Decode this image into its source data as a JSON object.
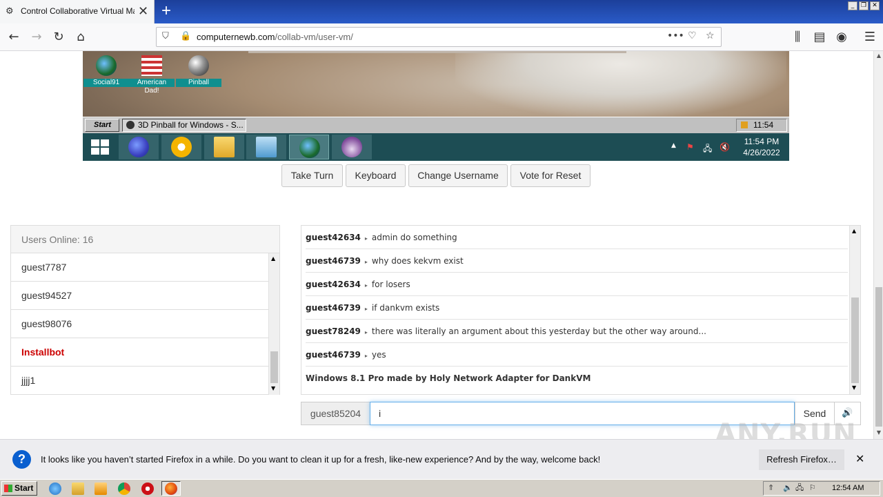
{
  "browser": {
    "tab_title": "Control Collaborative Virtual Machi",
    "url_domain": "computernewb.com",
    "url_path": "/collab-vm/user-vm/"
  },
  "vm": {
    "desktop_icons": [
      {
        "label": "Social91"
      },
      {
        "label": "American Dad!"
      },
      {
        "label": "Pinball"
      }
    ],
    "start_label": "Start",
    "task_label": "3D Pinball for Windows - S...",
    "guest_clock": "11:54 PM",
    "host_time": "11:54 PM",
    "host_date": "4/26/2022"
  },
  "actions": {
    "take_turn": "Take Turn",
    "keyboard": "Keyboard",
    "change_username": "Change Username",
    "vote_reset": "Vote for Reset"
  },
  "users": {
    "header": "Users Online: 16",
    "list": [
      {
        "name": "guest7787",
        "admin": false
      },
      {
        "name": "guest94527",
        "admin": false
      },
      {
        "name": "guest98076",
        "admin": false
      },
      {
        "name": "Installbot",
        "admin": true
      },
      {
        "name": "jjjj1",
        "admin": false
      }
    ]
  },
  "chat": {
    "messages": [
      {
        "user": "guest42634",
        "text": "admin do something"
      },
      {
        "user": "guest46739",
        "text": "why does kekvm exist"
      },
      {
        "user": "guest42634",
        "text": "for losers"
      },
      {
        "user": "guest46739",
        "text": "if dankvm exists"
      },
      {
        "user": "guest78249",
        "text": "there was literally an argument about this yesterday but the other way around..."
      },
      {
        "user": "guest46739",
        "text": "yes"
      }
    ],
    "system_message": "Windows 8.1 Pro made by Holy Network Adapter for DankVM",
    "username": "guest85204",
    "input_value": "i",
    "send_label": "Send"
  },
  "notification": {
    "text": "It looks like you haven’t started Firefox in a while. Do you want to clean it up for a fresh, like-new experience? And by the way, welcome back!",
    "button": "Refresh Firefox…"
  },
  "watermark": "ANY.RUN",
  "os": {
    "start_label": "Start",
    "clock": "12:54 AM"
  }
}
